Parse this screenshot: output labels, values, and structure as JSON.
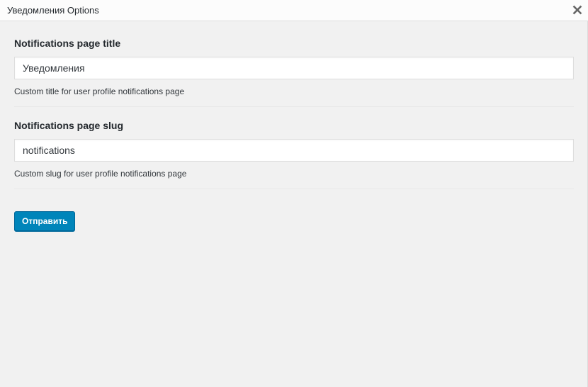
{
  "dialog": {
    "title": "Уведомления Options",
    "close_icon": "close-icon"
  },
  "fields": [
    {
      "label": "Notifications page title",
      "value": "Уведомления",
      "help": "Custom title for user profile notifications page"
    },
    {
      "label": "Notifications page slug",
      "value": "notifications",
      "help": "Custom slug for user profile notifications page"
    }
  ],
  "submit": {
    "label": "Отправить"
  },
  "colors": {
    "primary_button": "#0085ba",
    "background": "#f1f1f1",
    "titlebar": "#fcfcfc"
  }
}
